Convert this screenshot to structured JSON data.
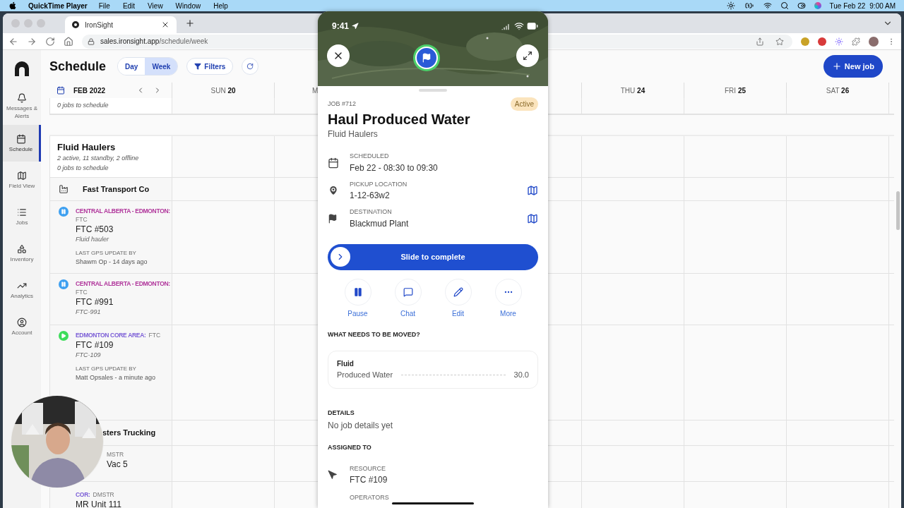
{
  "menubar": {
    "app": "QuickTime Player",
    "menus": [
      "File",
      "Edit",
      "View",
      "Window",
      "Help"
    ],
    "date": "Tue Feb 22",
    "time": "9:00 AM"
  },
  "browser": {
    "tab": {
      "title": "IronSight"
    },
    "url_host": "sales.ironsight.app",
    "url_path": "/schedule/week"
  },
  "sidebar": {
    "items": [
      {
        "label": "Messages & Alerts",
        "selected": false
      },
      {
        "label": "Schedule",
        "selected": true
      },
      {
        "label": "Field View",
        "selected": false
      },
      {
        "label": "Jobs",
        "selected": false
      },
      {
        "label": "Inventory",
        "selected": false
      },
      {
        "label": "Analytics",
        "selected": false
      },
      {
        "label": "Account",
        "selected": false
      }
    ]
  },
  "schedule": {
    "title": "Schedule",
    "views": [
      {
        "label": "Day",
        "selected": false
      },
      {
        "label": "Week",
        "selected": true
      }
    ],
    "filters": "Filters",
    "new_job": "New job",
    "month": "FEB 2022",
    "days": [
      {
        "day": "SUN",
        "date": "20"
      },
      {
        "day": "M"
      },
      {
        "day": "THU",
        "date": "24"
      },
      {
        "day": "FRI",
        "date": "25"
      },
      {
        "day": "SAT",
        "date": "26"
      }
    ],
    "rows": [
      {
        "kind": "group_tail",
        "note": "0 jobs to schedule"
      },
      {
        "kind": "group",
        "name": "Fluid Haulers",
        "summary": "2 active, 11 standby, 2 offline",
        "note": "0 jobs to schedule"
      },
      {
        "kind": "company",
        "name": "Fast Transport Co"
      },
      {
        "kind": "resource",
        "paused": true,
        "region": "CENTRAL ALBERTA - EDMONTON:",
        "color": "#b0359b",
        "fleet": "FTC",
        "name": "FTC #503",
        "subtitle": "Fluid hauler",
        "gps_label": "LAST GPS UPDATE BY",
        "gps": "Shawm Op - 14 days ago"
      },
      {
        "kind": "resource",
        "paused": true,
        "region": "CENTRAL ALBERTA - EDMONTON:",
        "color": "#b0359b",
        "fleet": "FTC",
        "name": "FTC #991",
        "subtitle": "FTC-991"
      },
      {
        "kind": "resource",
        "paused": false,
        "region": "EDMONTON CORE AREA:",
        "color": "#7a5cd6",
        "fleet": "FTC",
        "name": "FTC #109",
        "subtitle": "FTC-109",
        "gps_label": "LAST GPS UPDATE BY",
        "gps": "Matt Opsales - a minute ago"
      },
      {
        "kind": "group_clipped",
        "name": "sters Trucking"
      },
      {
        "kind": "resource_clipped",
        "fleet": "MSTR",
        "name": "Vac 5"
      },
      {
        "kind": "resource",
        "region": "COR:",
        "color": "#7a5cd6",
        "fleet": "DMSTR",
        "name": "MR Unit 111"
      }
    ]
  },
  "job_sheet": {
    "status_time": "9:41",
    "job_number": "JOB #712",
    "badge": "Active",
    "title": "Haul Produced Water",
    "subtitle": "Fluid Haulers",
    "details": [
      {
        "kind": "schedule",
        "label": "SCHEDULED",
        "value": "Feb 22 - 08:30 to 09:30"
      },
      {
        "kind": "pickup",
        "label": "PICKUP LOCATION",
        "value": "1-12-63w2"
      },
      {
        "kind": "destination",
        "label": "DESTINATION",
        "value": "Blackmud Plant"
      }
    ],
    "slider": "Slide to complete",
    "actions": [
      {
        "kind": "pause",
        "label": "Pause"
      },
      {
        "kind": "chat",
        "label": "Chat"
      },
      {
        "kind": "edit",
        "label": "Edit"
      },
      {
        "kind": "more",
        "label": "More"
      }
    ],
    "cargo_heading": "WHAT NEEDS TO BE MOVED?",
    "cargo": {
      "type": "Fluid",
      "name": "Produced Water",
      "amount": "30.0"
    },
    "details_heading": "DETAILS",
    "details_text": "No job details yet",
    "assigned_heading": "ASSIGNED TO",
    "assignments": [
      {
        "kind": "resource",
        "label": "RESOURCE",
        "value": "FTC #109"
      },
      {
        "kind": "operators",
        "label": "OPERATORS"
      }
    ]
  }
}
